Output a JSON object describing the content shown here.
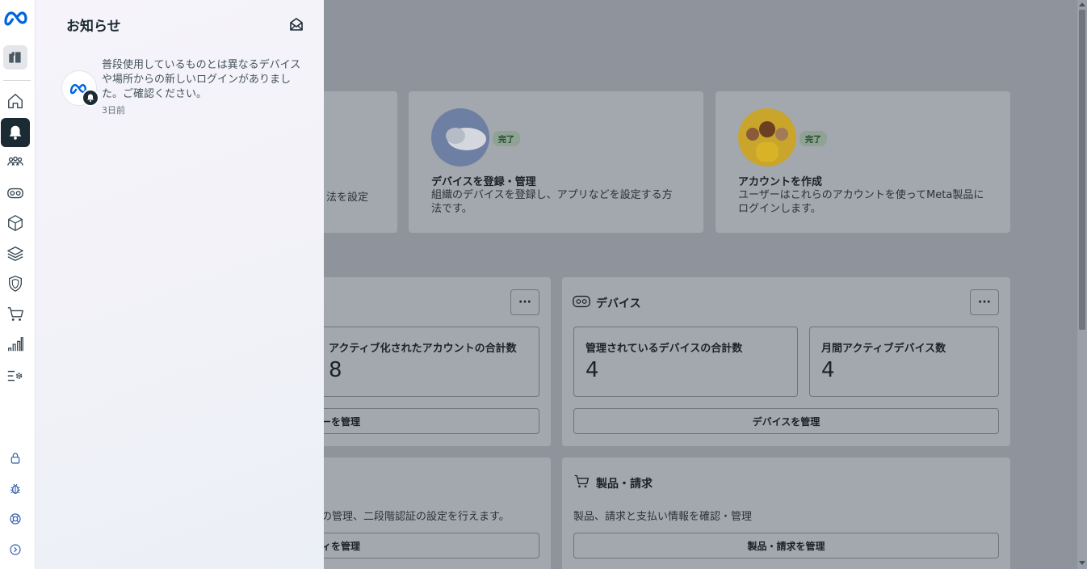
{
  "notifications_panel": {
    "title": "お知らせ",
    "items": [
      {
        "message": "普段使用しているものとは異なるデバイスや場所からの新しいログインがありました。ご確認ください。",
        "time": "3日前"
      }
    ]
  },
  "rail": {
    "icons": [
      "meta-logo",
      "org-icon",
      "home-icon",
      "bell-icon",
      "users-icon",
      "vr-headset-icon",
      "cube-icon",
      "layers-icon",
      "shield-icon",
      "cart-icon",
      "bar-chart-icon",
      "settings-list-icon",
      "lock-icon",
      "bug-icon",
      "help-icon",
      "expand-icon"
    ],
    "active": "bell-icon"
  },
  "background": {
    "setup_cards": [
      {
        "text_fragment": "法を設定"
      },
      {
        "badge": "完了",
        "title": "デバイスを登録・管理",
        "desc": "組織のデバイスを登録し、アプリなどを設定する方法です。"
      },
      {
        "badge": "完了",
        "title": "アカウントを作成",
        "desc": "ユーザーはこれらのアカウントを使ってMeta製品にログインします。"
      }
    ],
    "accounts_panel": {
      "more_label": "···",
      "stat_label": "アクティブ化されたアカウントの合計数",
      "stat_value": "8",
      "button_fragment": "ーを管理"
    },
    "devices_panel": {
      "title": "デバイス",
      "more_label": "···",
      "stats": [
        {
          "label": "管理されているデバイスの合計数",
          "value": "4"
        },
        {
          "label": "月間アクティブデバイス数",
          "value": "4"
        }
      ],
      "button": "デバイスを管理"
    },
    "security_panel": {
      "desc_fragment": "の管理、二段階認証の設定を行えます。",
      "button_fragment": "ィを管理"
    },
    "billing_panel": {
      "title": "製品・請求",
      "desc": "製品、請求と支払い情報を確認・管理",
      "button": "製品・請求を管理"
    }
  },
  "colors": {
    "brand": "#0064e0",
    "active_rail": "#1c2b33",
    "badge_done": "#1f4a2a"
  }
}
